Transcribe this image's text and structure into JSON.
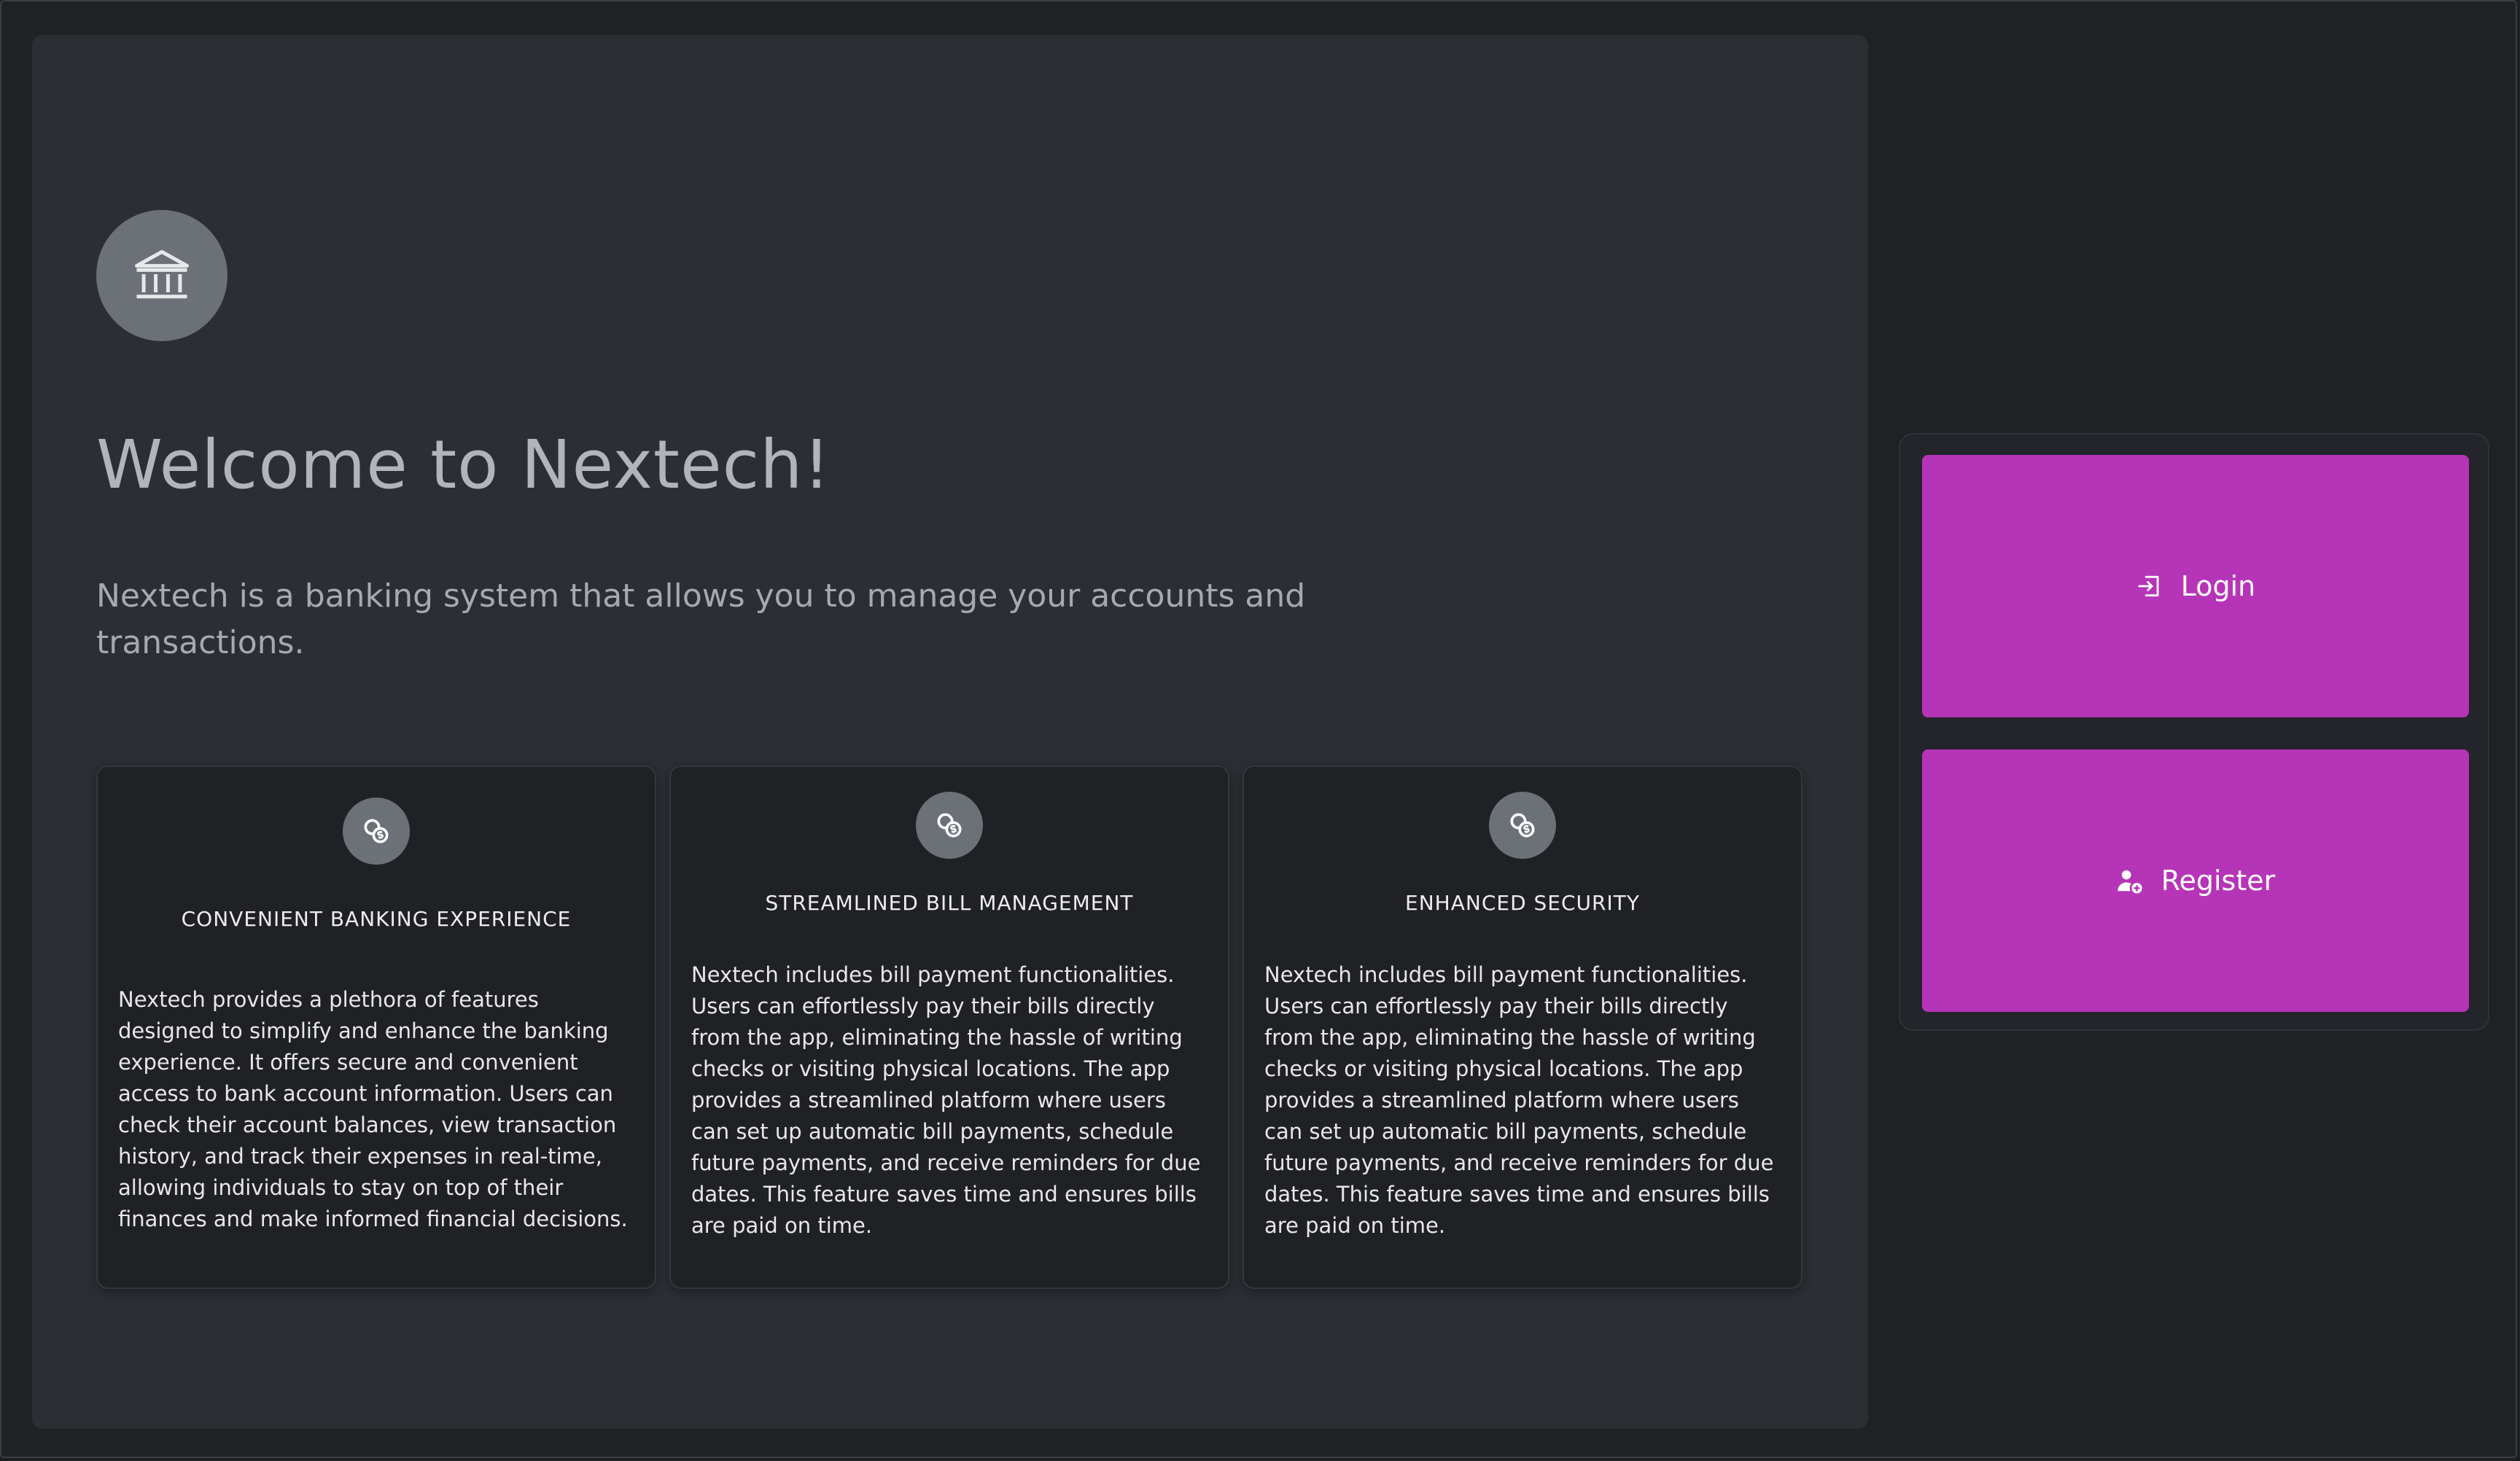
{
  "hero": {
    "logo_icon": "bank-icon",
    "title": "Welcome to Nextech!",
    "description": "Nextech is a banking system that allows you to manage your accounts and transactions."
  },
  "features": [
    {
      "icon": "coins-icon",
      "title": "CONVENIENT BANKING EXPERIENCE",
      "body": "Nextech provides a plethora of features designed to simplify and enhance the banking experience. It offers secure and convenient access to bank account information. Users can check their account balances, view transaction history, and track their expenses in real-time, allowing individuals to stay on top of their finances and make informed financial decisions."
    },
    {
      "icon": "coins-icon",
      "title": "STREAMLINED BILL MANAGEMENT",
      "body": "Nextech includes bill payment functionalities. Users can effortlessly pay their bills directly from the app, eliminating the hassle of writing checks or visiting physical locations. The app provides a streamlined platform where users can set up automatic bill payments, schedule future payments, and receive reminders for due dates. This feature saves time and ensures bills are paid on time."
    },
    {
      "icon": "coins-icon",
      "title": "ENHANCED SECURITY",
      "body": "Nextech includes bill payment functionalities. Users can effortlessly pay their bills directly from the app, eliminating the hassle of writing checks or visiting physical locations. The app provides a streamlined platform where users can set up automatic bill payments, schedule future payments, and receive reminders for due dates. This feature saves time and ensures bills are paid on time."
    }
  ],
  "actions": {
    "login_label": "Login",
    "login_icon": "login-icon",
    "register_label": "Register",
    "register_icon": "user-plus-icon"
  },
  "colors": {
    "accent": "#b634b8",
    "panel": "#2b2e33",
    "background": "#1f2125",
    "icon_circle": "#6c7178"
  }
}
